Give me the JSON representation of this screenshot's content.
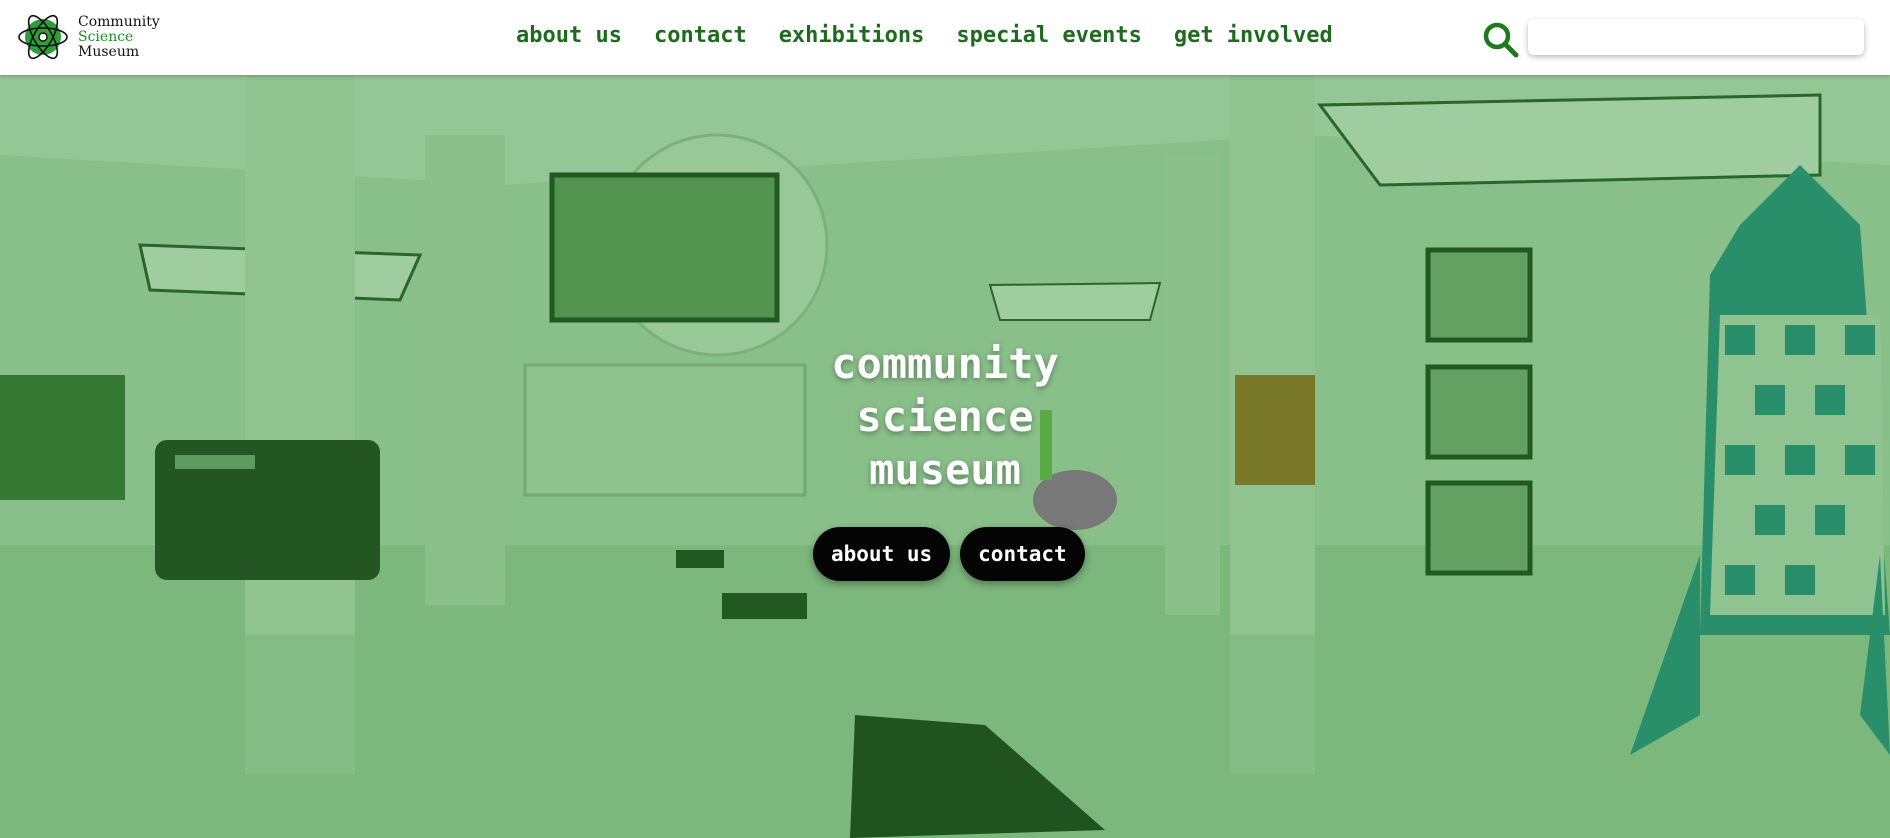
{
  "brand": {
    "line1": "Community",
    "line2": "Science",
    "line3": "Museum"
  },
  "nav": {
    "items": [
      {
        "label": "about us"
      },
      {
        "label": "contact"
      },
      {
        "label": "exhibitions"
      },
      {
        "label": "special events"
      },
      {
        "label": "get involved"
      }
    ]
  },
  "search": {
    "value": "",
    "icon": "search-icon"
  },
  "hero": {
    "title_lines": [
      "community",
      "science",
      "museum"
    ],
    "buttons": [
      {
        "label": "about us"
      },
      {
        "label": "contact"
      }
    ],
    "overlay_color": "#2e8b2e",
    "background": "museum-gallery-photo"
  },
  "colors": {
    "nav_text": "#1e6b1e",
    "brand_green": "#1e8c1e",
    "button_bg": "#050505",
    "button_text": "#ffffff"
  }
}
